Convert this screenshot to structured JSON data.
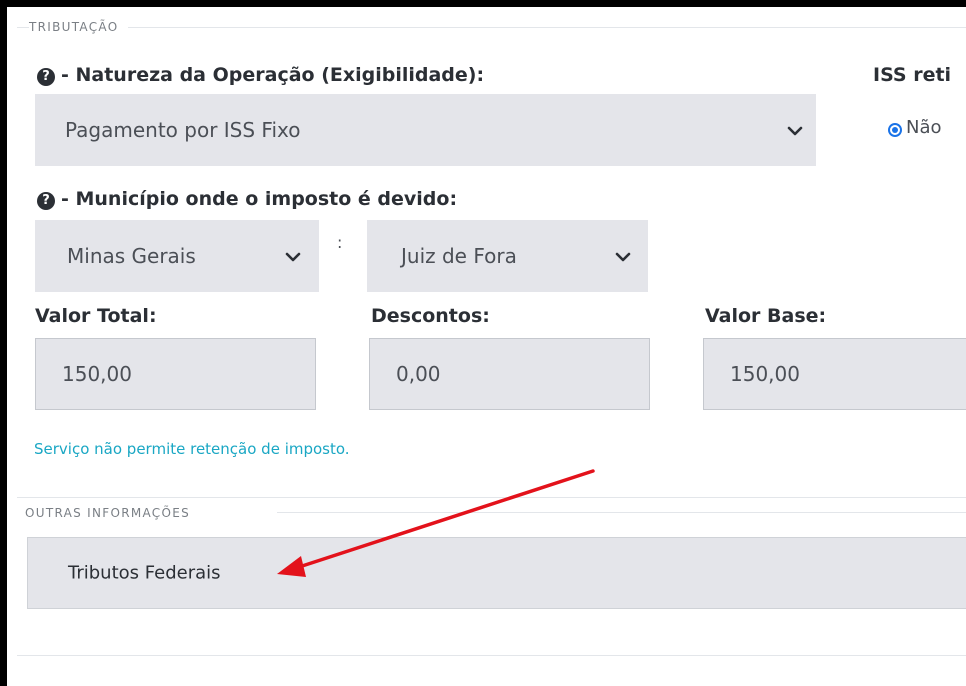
{
  "sections": {
    "tributacao": "TRIBUTAÇÃO",
    "outras": "OUTRAS INFORMAÇÕES"
  },
  "natureza": {
    "label": "- Natureza da Operação (Exigibilidade):",
    "value": "Pagamento por ISS Fixo"
  },
  "iss_retido": {
    "label": "ISS reti",
    "option": "Não"
  },
  "municipio": {
    "label": "- Município onde o imposto é devido:",
    "estado": "Minas Gerais",
    "separator": ":",
    "cidade": "Juiz de Fora"
  },
  "valores": {
    "total_label": "Valor Total:",
    "total": "150,00",
    "descontos_label": "Descontos:",
    "descontos": "0,00",
    "base_label": "Valor Base:",
    "base": "150,00"
  },
  "info": "Serviço não permite retenção de imposto.",
  "tributos_federais": "Tributos Federais",
  "icons": {
    "help": "question-circle-icon",
    "dropdown": "chevron-down-icon",
    "annotation": "red-arrow"
  },
  "colors": {
    "info": "#1aa7c4",
    "field_bg": "#e4e5ea",
    "arrow": "#e3121b",
    "radio": "#1a73e8"
  }
}
